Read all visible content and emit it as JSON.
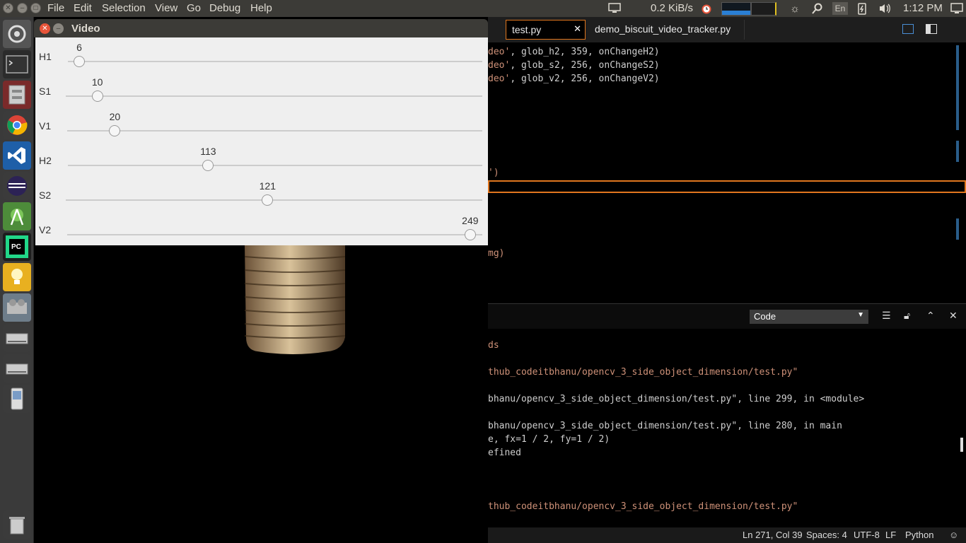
{
  "menubar": {
    "items": [
      "File",
      "Edit",
      "Selection",
      "View",
      "Go",
      "Debug",
      "Help"
    ],
    "net_speed": "0.2 KiB/s",
    "keyboard": "En",
    "time": "1:12 PM"
  },
  "launcher": {
    "apps": [
      "dash-icon",
      "terminal-icon",
      "files-icon",
      "chrome-icon",
      "vscode-icon",
      "eclipse-icon",
      "android-studio-icon",
      "pycharm-icon",
      "bulb-icon",
      "video-icon",
      "drive-icon",
      "drive-icon",
      "phone-icon",
      "trash-icon"
    ]
  },
  "video_window": {
    "title": "Video",
    "sliders": [
      {
        "label": "H1",
        "value": "6",
        "fraction": 0.0
      },
      {
        "label": "S1",
        "value": "10",
        "fraction": 0.05
      },
      {
        "label": "V1",
        "value": "20",
        "fraction": 0.09
      },
      {
        "label": "H2",
        "value": "113",
        "fraction": 0.32
      },
      {
        "label": "S2",
        "value": "121",
        "fraction": 0.47
      },
      {
        "label": "V2",
        "value": "249",
        "fraction": 0.97
      }
    ]
  },
  "editor": {
    "tabs": [
      {
        "label": "test.py",
        "active": true
      },
      {
        "label": "demo_biscuit_video_tracker.py",
        "active": false
      }
    ],
    "code_lines": [
      {
        "pre": "",
        "str": "deo'",
        "post": ", glob_h2, 359, onChangeH2)"
      },
      {
        "pre": "",
        "str": "deo'",
        "post": ", glob_s2, 256, onChangeS2)"
      },
      {
        "pre": "",
        "str": "deo'",
        "post": ", glob_v2, 256, onChangeV2)"
      }
    ],
    "code_fragments": [
      "')",
      "mg)"
    ],
    "panel": {
      "select_value": "Code",
      "output_lines": [
        "ds",
        "thub_codeitbhanu/opencv_3_side_object_dimension/test.py\"",
        "bhanu/opencv_3_side_object_dimension/test.py\", line 299, in <module>",
        "bhanu/opencv_3_side_object_dimension/test.py\", line 280, in main",
        "e, fx=1 / 2, fy=1 / 2)",
        "efined",
        "",
        "thub_codeitbhanu/opencv_3_side_object_dimension/test.py\""
      ]
    },
    "status": {
      "position": "Ln 271, Col 39",
      "spaces": "Spaces: 4",
      "encoding": "UTF-8",
      "eol": "LF",
      "language": "Python"
    }
  }
}
